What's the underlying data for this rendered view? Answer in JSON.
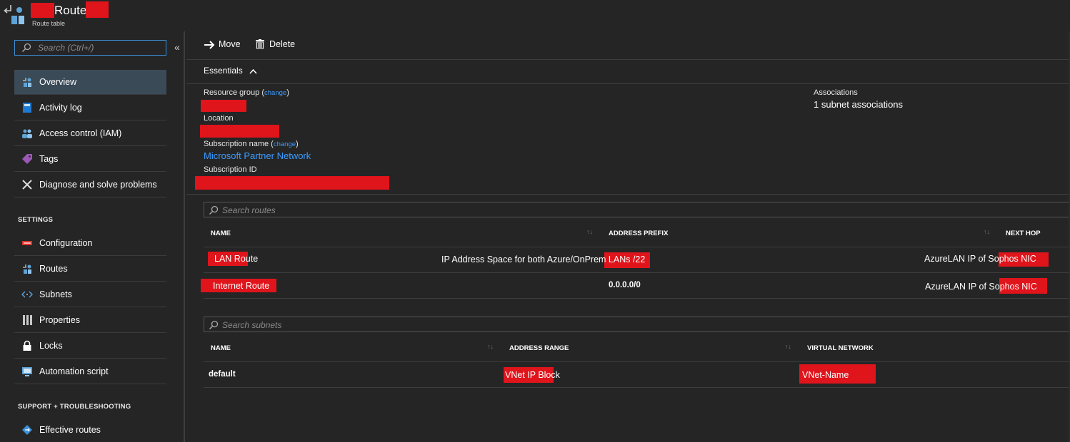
{
  "header": {
    "title": "Route",
    "subtitle": "Route table"
  },
  "sidebar": {
    "search_placeholder": "Search (Ctrl+/)",
    "items": [
      {
        "label": "Overview",
        "icon": "overview-icon",
        "active": true
      },
      {
        "label": "Activity log",
        "icon": "activity-log-icon"
      },
      {
        "label": "Access control (IAM)",
        "icon": "people-icon"
      },
      {
        "label": "Tags",
        "icon": "tag-icon"
      },
      {
        "label": "Diagnose and solve problems",
        "icon": "wrench-icon"
      }
    ],
    "settings_header": "SETTINGS",
    "settings_items": [
      {
        "label": "Configuration",
        "icon": "configuration-icon"
      },
      {
        "label": "Routes",
        "icon": "routes-icon"
      },
      {
        "label": "Subnets",
        "icon": "subnets-icon"
      },
      {
        "label": "Properties",
        "icon": "properties-icon"
      },
      {
        "label": "Locks",
        "icon": "lock-icon"
      },
      {
        "label": "Automation script",
        "icon": "automation-script-icon"
      }
    ],
    "support_header": "SUPPORT + TROUBLESHOOTING",
    "support_items": [
      {
        "label": "Effective routes",
        "icon": "effective-routes-icon"
      }
    ]
  },
  "toolbar": {
    "move_label": "Move",
    "delete_label": "Delete"
  },
  "essentials": {
    "title": "Essentials",
    "resource_group_label": "Resource group",
    "change_label": "change",
    "location_label": "Location",
    "subscription_name_label": "Subscription name",
    "subscription_name_value": "Microsoft Partner Network",
    "subscription_id_label": "Subscription ID",
    "associations_label": "Associations",
    "associations_value": "1 subnet associations"
  },
  "routes": {
    "search_placeholder": "Search routes",
    "columns": [
      "NAME",
      "ADDRESS PREFIX",
      "NEXT HOP"
    ],
    "rows": [
      {
        "name": "LAN Route",
        "prefix": "IP Address Space for both Azure/OnPrem LANs /22",
        "next_hop": "AzureLAN IP of Sophos NIC"
      },
      {
        "name": "Internet Route",
        "prefix": "0.0.0.0/0",
        "next_hop": "AzureLAN IP of Sophos NIC"
      }
    ]
  },
  "subnets": {
    "search_placeholder": "Search subnets",
    "columns": [
      "NAME",
      "ADDRESS RANGE",
      "VIRTUAL NETWORK"
    ],
    "rows": [
      {
        "name": "default",
        "range": "VNet IP Block",
        "vnet": "VNet-Name"
      }
    ]
  },
  "colors": {
    "background": "#252526",
    "accent": "#3b8fd8",
    "link": "#3b9cff",
    "redaction": "#e0141b"
  }
}
